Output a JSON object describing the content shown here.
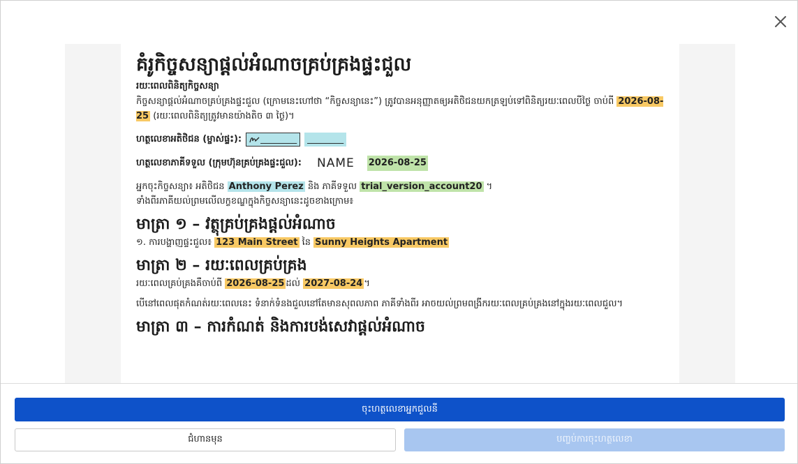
{
  "document": {
    "title": "គំរូកិច្ចសន្យាផ្តល់អំណាចគ្រប់គ្រងផ្ទះជួល",
    "term_heading": "រយៈពេលពិនិត្យកិច្ចសន្យា",
    "intro_part1": "កិច្ចសន្យាផ្តល់អំណាចគ្រប់គ្រងផ្ទះជួល (ក្រោមនេះហៅថា “កិច្ចសន្យានេះ”) ត្រូវបានអនុញ្ញាតឲ្យអតិថិជនយកត្រឡប់ទៅពិនិត្យរយៈពេលបីថ្ងៃ ចាប់ពី",
    "intro_date": "2026-08-25",
    "intro_part2": " (រយៈពេលពិនិត្យត្រូវមានយ៉ាងតិច ៣ ថ្ងៃ)។",
    "client_sig_label": "ហត្ថលេខាអតិថិជន (ម្ចាស់ផ្ទះ):",
    "client_sig_blank": "________",
    "receiver_sig_label": "ហត្ថលេខាភាគីទទួល (ក្រុមហ៊ុនគ្រប់គ្រងផ្ទះជួល):",
    "receiver_sig_name": "NAME",
    "receiver_sig_date": "2026-08-25",
    "parties_part1": "អ្នកចុះកិច្ចសន្យា៖ អតិថិជន ",
    "client_name": "Anthony Perez",
    "parties_part2": " និង ភាគីទទួល ",
    "receiver_name": "trial_version_account20",
    "parties_part3": " ។",
    "parties_line2": "ទាំងពីរភាគីយល់ព្រមលើលក្ខខណ្ឌក្នុងកិច្ចសន្យានេះដូចខាងក្រោម៖",
    "article1_heading": "មាត្រា ១ – វត្ថុគ្រប់គ្រងផ្តល់អំណាច",
    "article1_part1": "១. ការបង្ហាញផ្ទះជួល៖ ",
    "property_address": "123 Main Street",
    "article1_part2": " នៃ ",
    "property_name": "Sunny Heights Apartment",
    "article2_heading": "មាត្រា ២ – រយៈពេលគ្រប់គ្រង",
    "article2_part1": "រយៈពេលគ្រប់គ្រងគឺចាប់ពី ",
    "start_date": "2026-08-25",
    "article2_part2": "ដល់ ",
    "end_date": "2027-08-24",
    "article2_part3": "។",
    "article2_para2": "បើនៅពេលផុតកំណត់រយៈពេលនេះ ទំនាក់ទំនងជួលនៅតែមានសុពលភាព ភាគីទាំងពីរ អាចយល់ព្រមពង្រីករយៈពេលគ្រប់គ្រងនៅក្នុងរយៈពេលជួល។",
    "article3_heading": "មាត្រា ៣ – ការកំណត់ និងការបង់សេវាផ្តល់អំណាច"
  },
  "buttons": {
    "sign_tenant": "ចុះហត្ថលេខាអ្នកជួលនី",
    "back": "ជំហានមុន",
    "finish_signing": "បញ្ចប់ការចុះហត្ថលេខា"
  }
}
